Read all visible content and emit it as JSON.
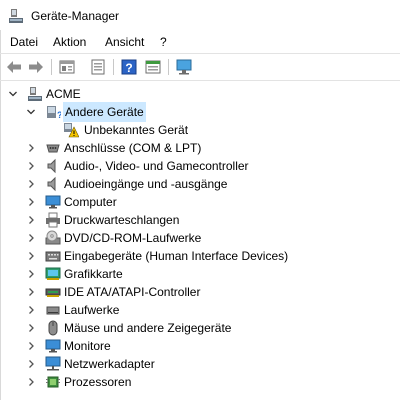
{
  "window": {
    "title": "Geräte-Manager"
  },
  "menu": [
    "Datei",
    "Aktion",
    "Ansicht",
    "?"
  ],
  "toolbar": {
    "buttons": [
      "back-icon",
      "forward-icon",
      "properties-icon",
      "show-hide-icon",
      "help-icon",
      "device-view-icon",
      "scan-hardware-icon"
    ]
  },
  "tree": {
    "root": "ACME",
    "categories": [
      {
        "label": "Andere Geräte",
        "expanded": true,
        "children": [
          "Unbekanntes Gerät"
        ]
      },
      {
        "label": "Anschlüsse (COM & LPT)"
      },
      {
        "label": "Audio-, Video- und Gamecontroller"
      },
      {
        "label": "Audioeingänge und -ausgänge"
      },
      {
        "label": "Computer"
      },
      {
        "label": "Druckwarteschlangen"
      },
      {
        "label": "DVD/CD-ROM-Laufwerke"
      },
      {
        "label": "Eingabegeräte (Human Interface Devices)"
      },
      {
        "label": "Grafikkarte"
      },
      {
        "label": "IDE ATA/ATAPI-Controller"
      },
      {
        "label": "Laufwerke"
      },
      {
        "label": "Mäuse und andere Zeigegeräte"
      },
      {
        "label": "Monitore"
      },
      {
        "label": "Netzwerkadapter"
      },
      {
        "label": "Prozessoren"
      }
    ]
  },
  "colors": {
    "selection": "#cce8ff",
    "accent": "#1e6fd9",
    "warning": "#f5c400"
  }
}
